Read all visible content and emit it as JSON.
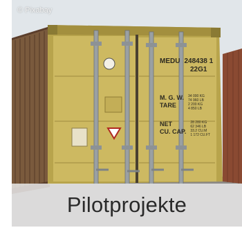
{
  "photo": {
    "credit": "© Pixabay",
    "container_code": "MEDU",
    "container_number": "248438 1",
    "size_type": "22G1",
    "weight_label_1": "M. G. W.",
    "weight_label_2": "TARE",
    "weight_values_1": [
      "34 000 KG",
      "74 960 LB"
    ],
    "weight_values_2": [
      "2 200 KG",
      "4 850 LB"
    ],
    "capacity_label_1": "NET",
    "capacity_label_2": "CU. CAP.",
    "capacity_values_1": [
      "28 280 KG",
      "62 346 LB"
    ],
    "capacity_values_2": [
      "33.2 CU.M",
      "1 172 CU.FT"
    ]
  },
  "caption": {
    "text": "Pilotprojekte"
  },
  "colors": {
    "container": "#c9b55a",
    "caption_band": "#e8e8e8",
    "caption_text": "#2a2a2a",
    "sky": "#dfe4e8"
  }
}
